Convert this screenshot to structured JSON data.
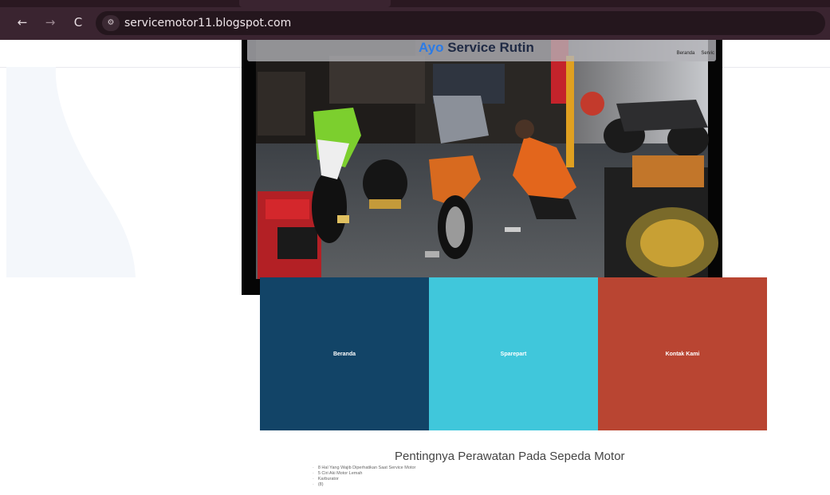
{
  "browser": {
    "url": "servicemotor11.blogspot.com",
    "back_icon": "←",
    "forward_icon": "→",
    "reload_icon": "C",
    "site_info_icon": "⚙"
  },
  "header": {
    "title_accent": "Ayo",
    "title_rest": " Service Rutin",
    "nav": [
      "Beranda",
      "Servic"
    ]
  },
  "tiles": [
    {
      "label": "Beranda",
      "color": "#124467"
    },
    {
      "label": "Sparepart",
      "color": "#40c7db"
    },
    {
      "label": "Kontak Kami",
      "color": "#b94532"
    }
  ],
  "article": {
    "title": "Pentingnya Perawatan Pada Sepeda Motor",
    "items": [
      "8 Hal Yang Wajib Diperhatikan Saat Service Motor",
      "5 Ciri Aki Motor Lemah",
      "Karburator",
      "(8)"
    ]
  }
}
